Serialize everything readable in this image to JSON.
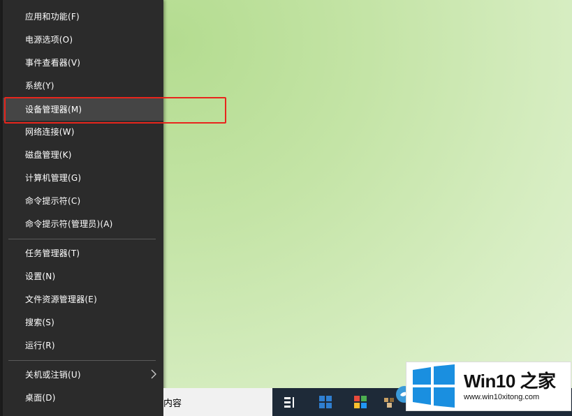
{
  "menu": {
    "items": [
      {
        "label": "应用和功能(F)"
      },
      {
        "label": "电源选项(O)"
      },
      {
        "label": "事件查看器(V)"
      },
      {
        "label": "系统(Y)"
      },
      {
        "label": "设备管理器(M)",
        "highlighted": true
      },
      {
        "label": "网络连接(W)"
      },
      {
        "label": "磁盘管理(K)"
      },
      {
        "label": "计算机管理(G)"
      },
      {
        "label": "命令提示符(C)"
      },
      {
        "label": "命令提示符(管理员)(A)"
      },
      {
        "label": "任务管理器(T)"
      },
      {
        "label": "设置(N)"
      },
      {
        "label": "文件资源管理器(E)"
      },
      {
        "label": "搜索(S)"
      },
      {
        "label": "运行(R)"
      },
      {
        "label": "关机或注销(U)",
        "has_submenu": true
      },
      {
        "label": "桌面(D)"
      }
    ]
  },
  "taskbar": {
    "search_text": "内容",
    "icons": [
      "task-view-icon",
      "windows-tile-icon",
      "colorful-app-icon",
      "pixel-app-icon",
      "bird-app-icon"
    ]
  },
  "watermark": {
    "brand": "Win10 之家",
    "url": "www.win10xitong.com"
  },
  "colors": {
    "menu_bg": "#2b2b2b",
    "highlight_bg": "#454545",
    "callout": "#e8251c",
    "logo_blue": "#1a8fe0",
    "taskbar": "#1e2a38"
  }
}
